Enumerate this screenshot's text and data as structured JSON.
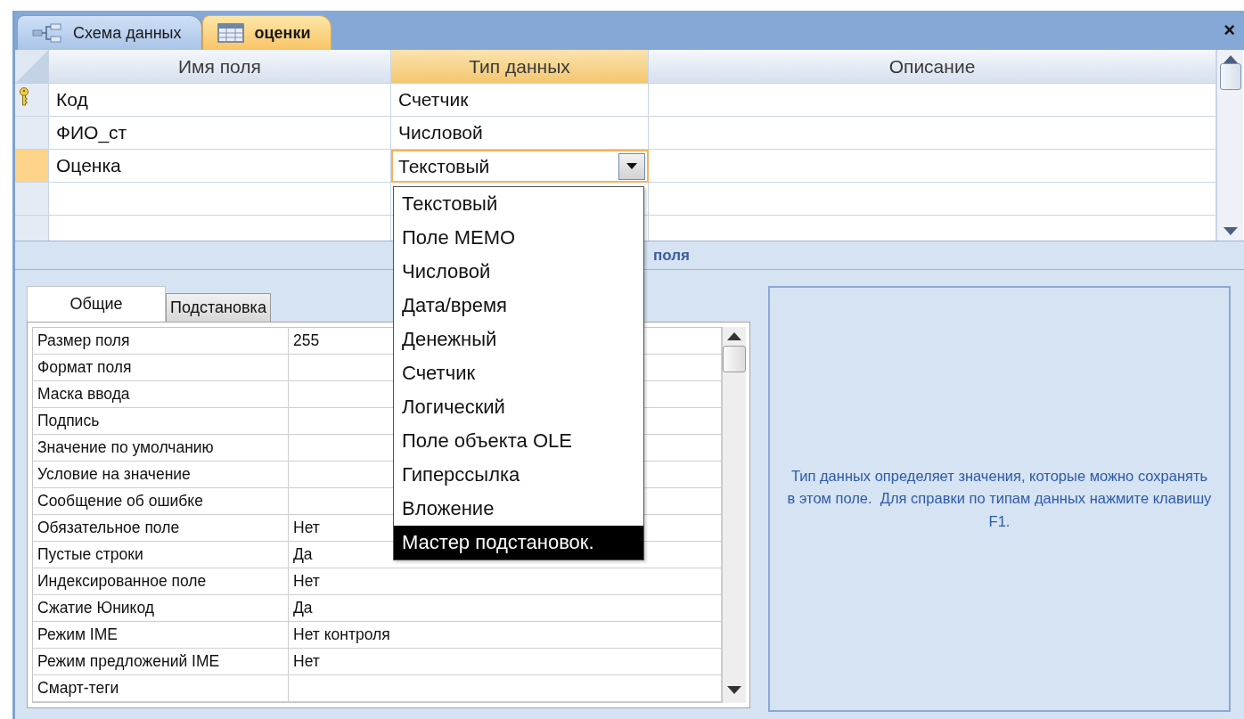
{
  "document_tabs": [
    {
      "label": "Схема данных",
      "selected": false
    },
    {
      "label": "оценки",
      "selected": true
    }
  ],
  "close_button": "×",
  "grid": {
    "columns": [
      {
        "label": "Имя поля",
        "selected": false
      },
      {
        "label": "Тип данных",
        "selected": true
      },
      {
        "label": "Описание",
        "selected": false
      }
    ],
    "rows": [
      {
        "name": "Код",
        "type": "Счетчик",
        "primary_key": true,
        "selected": false
      },
      {
        "name": "ФИО_ст",
        "type": "Числовой",
        "primary_key": false,
        "selected": false
      },
      {
        "name": "Оценка",
        "type": "Текстовый",
        "primary_key": false,
        "selected": true
      },
      {
        "primary_key": false,
        "selected": false
      },
      {
        "primary_key": false,
        "selected": false
      }
    ]
  },
  "type_dropdown": {
    "items": [
      {
        "label": "Текстовый",
        "selected": false
      },
      {
        "label": "Поле MEMO",
        "selected": false
      },
      {
        "label": "Числовой",
        "selected": false
      },
      {
        "label": "Дата/время",
        "selected": false
      },
      {
        "label": "Денежный",
        "selected": false
      },
      {
        "label": "Счетчик",
        "selected": false
      },
      {
        "label": "Логический",
        "selected": false
      },
      {
        "label": "Поле объекта OLE",
        "selected": false
      },
      {
        "label": "Гиперссылка",
        "selected": false
      },
      {
        "label": "Вложение",
        "selected": false
      },
      {
        "label": "Мастер подстановок.",
        "selected": true
      }
    ]
  },
  "section_label": "поля",
  "property_tabs": [
    {
      "label": "Общие",
      "selected": true
    },
    {
      "label": "Подстановка",
      "selected": false
    }
  ],
  "properties": [
    {
      "label": "Размер поля",
      "value": "255"
    },
    {
      "label": "Формат поля"
    },
    {
      "label": "Маска ввода"
    },
    {
      "label": "Подпись"
    },
    {
      "label": "Значение по умолчанию"
    },
    {
      "label": "Условие на значение"
    },
    {
      "label": "Сообщение об ошибке"
    },
    {
      "label": "Обязательное поле",
      "value": "Нет"
    },
    {
      "label": "Пустые строки",
      "value": "Да"
    },
    {
      "label": "Индексированное поле",
      "value": "Нет"
    },
    {
      "label": "Сжатие Юникод",
      "value": "Да"
    },
    {
      "label": "Режим IME",
      "value": "Нет контроля"
    },
    {
      "label": "Режим предложений IME",
      "value": "Нет"
    },
    {
      "label": "Смарт-теги"
    }
  ],
  "help_text": "Тип данных определяет значения, которые можно сохранять в этом поле.  Для справки по типам данных нажмите клавишу F1."
}
